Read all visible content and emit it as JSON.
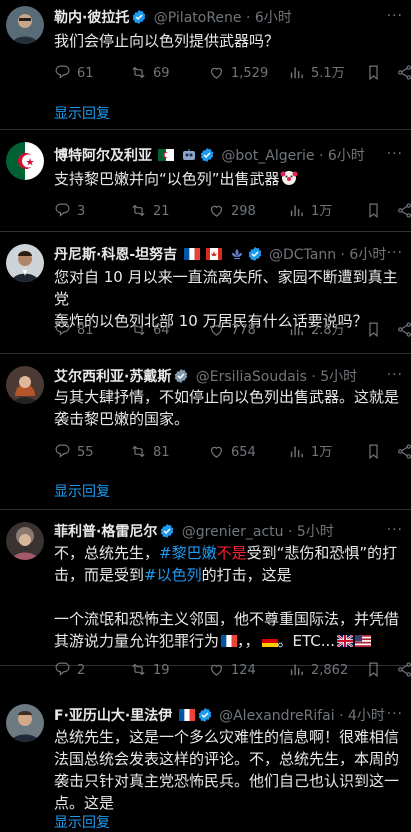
{
  "tweets": [
    {
      "name": "勒内·彼拉托",
      "handle": "@PilatoRene",
      "time": "· 6小时",
      "text": "我们会停止向以色列提供武器吗？",
      "replies": "61",
      "retweets": "69",
      "likes": "1,529",
      "views": "5.1万",
      "show_replies": "显示回复"
    },
    {
      "name": "博特阿尔及利亚",
      "handle": "@bot_Algerie",
      "time": "· 6小时",
      "text": "支持黎巴嫩并向“以色列”出售武器",
      "replies": "3",
      "retweets": "21",
      "likes": "298",
      "views": "1万"
    },
    {
      "name": "丹尼斯·科恩-坦努吉",
      "handle": "@DCTann",
      "time": "· 6小时",
      "text_line1": "您对自 10 月以来一直流离失所、家园不断遭到真主党",
      "text_line2": "轰炸的以色列北部 10 万居民有什么话要说吗？",
      "replies": "81",
      "retweets": "64",
      "likes": "778",
      "views": "2.8万"
    },
    {
      "name": "艾尔西利亚·苏戴斯",
      "handle": "@ErsiliaSoudais",
      "time": "· 5小时",
      "text_line1": "与其大肆抒情，不如停止向以色列出售武器。这就是",
      "text_line2": "袭击黎巴嫩的国家。",
      "replies": "55",
      "retweets": "81",
      "likes": "654",
      "views": "1万",
      "show_replies": "显示回复"
    },
    {
      "name": "菲利普·格雷尼尔",
      "handle": "@grenier_actu",
      "time": "· 5小时",
      "l1_a": "不，总统先生，",
      "l1_hash": "#黎巴嫩",
      "l1_red": "不是",
      "l1_b": "受到“悲伤和恐惧”的打",
      "l2_a": "击，而是受到",
      "l2_hash": "#以色列",
      "l2_b": "的打击，这是",
      "l3": "一个流氓和恐怖主义邻国，他不尊重国际法，并凭借",
      "l4": "其游说力量允许犯罪行为",
      "l4_b": "，，",
      "l4_c": "。ETC...",
      "replies": "2",
      "retweets": "19",
      "likes": "124",
      "views": "2,862"
    },
    {
      "name": "F·亚历山大·里法伊",
      "handle": "@AlexandreRifai",
      "time": "· 4小时",
      "text_line1": "总统先生，这是一个多么灾难性的信息啊！很难相信",
      "text_line2": "法国总统会发表这样的评论。不，总统先生，本周的",
      "text_line3": "袭击只针对真主党恐怖民兵。他们自己也认识到这一",
      "text_line4": "点。这是",
      "show_replies": "显示回复"
    }
  ],
  "colors": {
    "accent": "#1d9bf0",
    "muted": "#71767b",
    "text": "#e7e9ea",
    "bg": "#000000"
  }
}
